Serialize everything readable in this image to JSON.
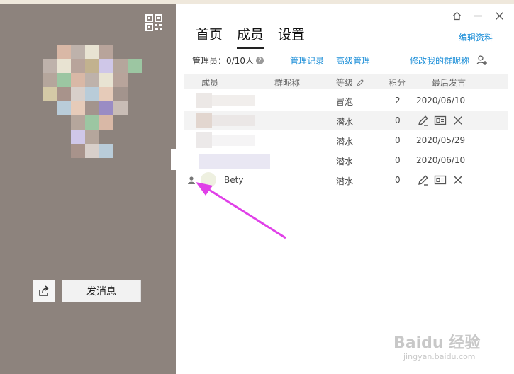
{
  "left_panel": {
    "send_message_label": "发消息",
    "icons": {
      "qr": "qr-code-icon",
      "share": "share-icon"
    }
  },
  "tabs": [
    {
      "label": "首页",
      "active": false
    },
    {
      "label": "成员",
      "active": true
    },
    {
      "label": "设置",
      "active": false
    }
  ],
  "window_controls": {
    "home": "house-icon",
    "minimize": "minimize-icon",
    "close": "close-icon"
  },
  "edit_profile_link": "编辑资料",
  "admin_info": "管理员：0/10人",
  "links": {
    "manage_log": "管理记录",
    "advanced_manage": "高级管理",
    "change_nickname": "修改我的群昵称"
  },
  "table": {
    "columns": [
      "成员",
      "群昵称",
      "等级",
      "积分",
      "最后发言"
    ],
    "rows": [
      {
        "name": "",
        "level": "冒泡",
        "points": "2",
        "last": "2020/06/10",
        "actions": false
      },
      {
        "name": "",
        "level": "潜水",
        "points": "0",
        "last": "",
        "actions": true
      },
      {
        "name": "",
        "level": "潜水",
        "points": "0",
        "last": "2020/05/29",
        "actions": false
      },
      {
        "name": "",
        "level": "潜水",
        "points": "0",
        "last": "2020/06/10",
        "actions": false
      },
      {
        "name": "Bety",
        "level": "潜水",
        "points": "0",
        "last": "",
        "actions": true
      }
    ]
  },
  "watermark": {
    "brand": "Baidu 经验",
    "url": "jingyan.baidu.com"
  },
  "colors": {
    "left_panel": "#8d837d",
    "link": "#1d8fd8",
    "arrow": "#e040e8"
  }
}
